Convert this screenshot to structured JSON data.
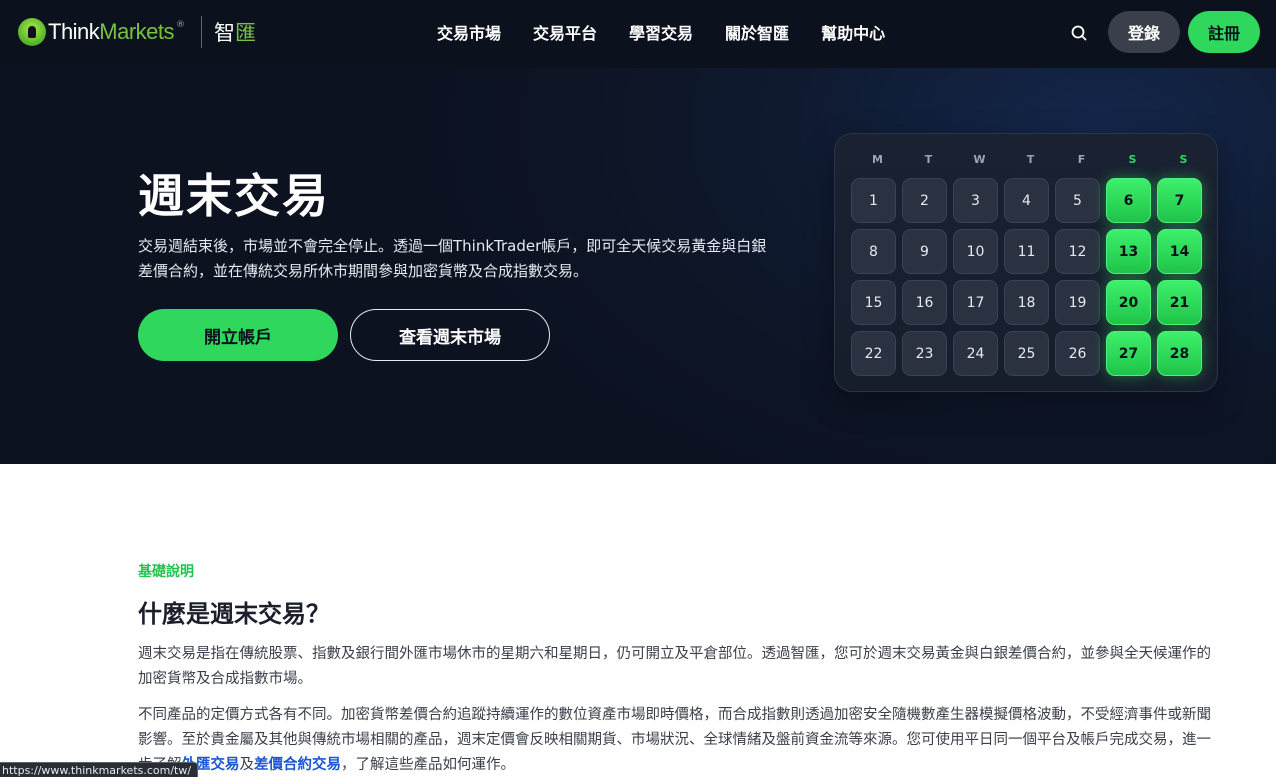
{
  "header": {
    "logo_part1": "Think",
    "logo_part2": "Markets",
    "logo_reg": "®",
    "logo_zh1": "智",
    "logo_zh2": "匯",
    "nav": [
      "交易市場",
      "交易平台",
      "學習交易",
      "關於智匯",
      "幫助中心"
    ],
    "search_icon": "search-icon",
    "login_label": "登錄",
    "register_label": "註冊"
  },
  "hero": {
    "title": "週末交易",
    "description": "交易週結束後，市場並不會完全停止。透過一個ThinkTrader帳戶，即可全天候交易黃金與白銀差價合約，並在傳統交易所休市期間參與加密貨幣及合成指數交易。",
    "cta_primary": "開立帳戶",
    "cta_secondary": "查看週末市場",
    "calendar": {
      "weekdays": [
        "M",
        "T",
        "W",
        "T",
        "F",
        "S",
        "S"
      ],
      "weeks": [
        [
          "1",
          "2",
          "3",
          "4",
          "5",
          "6",
          "7"
        ],
        [
          "8",
          "9",
          "10",
          "11",
          "12",
          "13",
          "14"
        ],
        [
          "15",
          "16",
          "17",
          "18",
          "19",
          "20",
          "21"
        ],
        [
          "22",
          "23",
          "24",
          "25",
          "26",
          "27",
          "28"
        ]
      ]
    }
  },
  "content": {
    "eyebrow": "基礎說明",
    "title": "什麼是週末交易？",
    "para1": "週末交易是指在傳統股票、指數及銀行間外匯市場休市的星期六和星期日，仍可開立及平倉部位。透過智匯，您可於週末交易黃金與白銀差價合約，並參與全天候運作的加密貨幣及合成指數市場。",
    "para2_text": "不同產品的定價方式各有不同。加密貨幣差價合約追蹤持續運作的數位資產市場即時價格，而合成指數則透過加密安全隨機數產生器模擬價格波動，不受經濟事件或新聞影響。至於貴金屬及其他與傳統市場相關的產品，週末定價會反映相關期貨、市場狀況、全球情緒及盤前資金流等來源。您可使用平日同一個平台及帳戶完成交易，進一步了解",
    "para2_link1": "外匯交易",
    "para2_mid": "及",
    "para2_link2": "差價合約交易",
    "para2_end": "，了解這些產品如何運作。"
  },
  "status_bar": {
    "url": "https://www.thinkmarkets.com/tw/"
  },
  "colors": {
    "accent_green": "#2fd85c",
    "header_bg": "#0b111d",
    "link_blue": "#1a56d6"
  }
}
